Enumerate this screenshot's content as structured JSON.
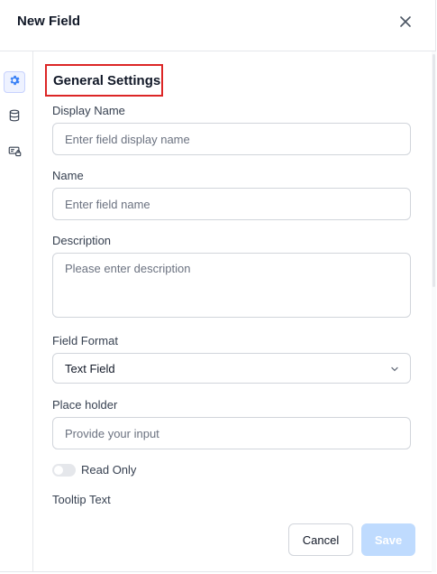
{
  "dialog": {
    "title": "New Field"
  },
  "sidebar": {
    "items": [
      {
        "name": "general-settings",
        "icon": "gear-icon",
        "active": true
      },
      {
        "name": "data-source",
        "icon": "database-icon",
        "active": false
      },
      {
        "name": "permissions",
        "icon": "id-card-lock-icon",
        "active": false
      }
    ]
  },
  "section": {
    "title": "General Settings"
  },
  "form": {
    "display_name": {
      "label": "Display Name",
      "placeholder": "Enter field display name",
      "value": ""
    },
    "name": {
      "label": "Name",
      "placeholder": "Enter field name",
      "value": ""
    },
    "description": {
      "label": "Description",
      "placeholder": "Please enter description",
      "value": ""
    },
    "field_format": {
      "label": "Field Format",
      "value": "Text Field"
    },
    "placeholder": {
      "label": "Place holder",
      "placeholder": "Provide your input",
      "value": ""
    },
    "read_only": {
      "label": "Read Only",
      "checked": false
    },
    "tooltip": {
      "label": "Tooltip Text"
    }
  },
  "footer": {
    "cancel_label": "Cancel",
    "save_label": "Save"
  },
  "colors": {
    "accent": "#3b82f6",
    "save_disabled": "#bfdbfe",
    "highlight_border": "#dc2626"
  }
}
